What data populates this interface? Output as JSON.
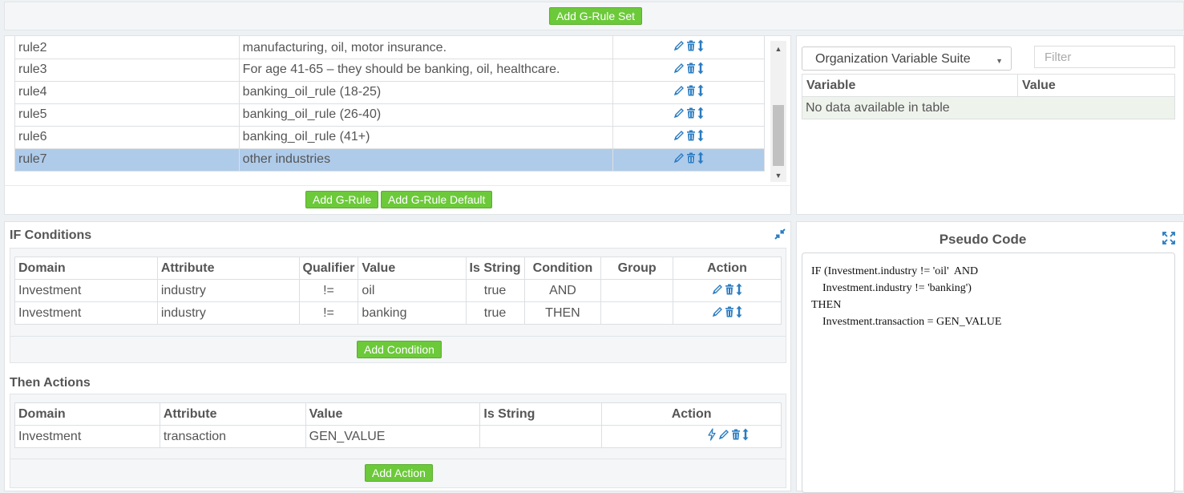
{
  "top": {
    "add_rule_set_label": "Add G-Rule Set"
  },
  "rules": {
    "rows": [
      {
        "name": "rule2",
        "description": "manufacturing, oil, motor insurance."
      },
      {
        "name": "rule3",
        "description": "For age 41-65 – they should be banking, oil, healthcare."
      },
      {
        "name": "rule4",
        "description": "banking_oil_rule (18-25)"
      },
      {
        "name": "rule5",
        "description": "banking_oil_rule (26-40)"
      },
      {
        "name": "rule6",
        "description": "banking_oil_rule (41+)"
      },
      {
        "name": "rule7",
        "description": "other industries",
        "selected": true
      }
    ],
    "add_rule_label": "Add G-Rule",
    "add_rule_default_label": "Add G-Rule Default"
  },
  "variables": {
    "suite_selected": "Organization Variable Suite",
    "filter_placeholder": "Filter",
    "columns": [
      "Variable",
      "Value"
    ],
    "empty_text": "No data available in table"
  },
  "if_conditions": {
    "title": "IF Conditions",
    "columns": [
      "Domain",
      "Attribute",
      "Qualifier",
      "Value",
      "Is String",
      "Condition",
      "Group",
      "Action"
    ],
    "rows": [
      {
        "domain": "Investment",
        "attribute": "industry",
        "qualifier": "!=",
        "value": "oil",
        "is_string": "true",
        "condition": "AND",
        "group": ""
      },
      {
        "domain": "Investment",
        "attribute": "industry",
        "qualifier": "!=",
        "value": "banking",
        "is_string": "true",
        "condition": "THEN",
        "group": ""
      }
    ],
    "add_condition_label": "Add Condition"
  },
  "then_actions": {
    "title": "Then Actions",
    "columns": [
      "Domain",
      "Attribute",
      "Value",
      "Is String",
      "Action"
    ],
    "rows": [
      {
        "domain": "Investment",
        "attribute": "transaction",
        "value": "GEN_VALUE",
        "is_string": ""
      }
    ],
    "add_action_label": "Add Action"
  },
  "pseudo_code": {
    "title": "Pseudo Code",
    "lines": [
      "IF (Investment.industry != 'oil'  AND",
      "    Investment.industry != 'banking')",
      "THEN",
      "    Investment.transaction = GEN_VALUE"
    ]
  },
  "icons": {
    "edit": "pencil-icon",
    "delete": "trash-icon",
    "move": "updown-arrow-icon",
    "run": "lightning-icon",
    "compress": "compress-icon",
    "expand": "expand-icon"
  },
  "colors": {
    "accent_button": "#6cc93a",
    "link": "#2a7cc1",
    "selected_row": "#afcbea"
  }
}
